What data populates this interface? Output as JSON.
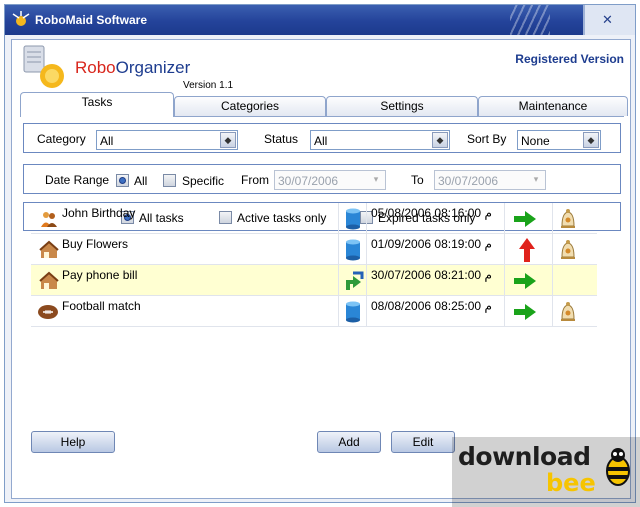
{
  "window": {
    "title": "RoboMaid Software"
  },
  "header": {
    "brand_part1": "Robo",
    "brand_part2": "Organizer",
    "version": "Version 1.1",
    "registration": "Registered Version"
  },
  "tabs": [
    {
      "label": "Tasks",
      "active": true
    },
    {
      "label": "Categories",
      "active": false
    },
    {
      "label": "Settings",
      "active": false
    },
    {
      "label": "Maintenance",
      "active": false
    }
  ],
  "filters": {
    "category_label": "Category",
    "category_value": "All",
    "status_label": "Status",
    "status_value": "All",
    "sortby_label": "Sort By",
    "sortby_value": "None"
  },
  "date_range": {
    "label": "Date Range",
    "option_all": "All",
    "option_specific": "Specific",
    "selected": "All",
    "from_label": "From",
    "from_value": "30/07/2006",
    "to_label": "To",
    "to_value": "30/07/2006"
  },
  "task_filter": {
    "option_all": "All tasks",
    "option_active": "Active tasks only",
    "option_expired": "Expired tasks only",
    "selected": "All tasks"
  },
  "tasks": [
    {
      "name": "John Birthday",
      "datetime": "05/08/2006 08:16:00 م",
      "category_icon": "people-icon",
      "status_icon": "database-icon",
      "action_icon": "right-arrow-icon",
      "alarm_icon": "alarm-bell-icon",
      "selected": false
    },
    {
      "name": "Buy Flowers",
      "datetime": "01/09/2006 08:19:00 م",
      "category_icon": "house-icon",
      "status_icon": "database-icon",
      "action_icon": "up-arrow-icon",
      "alarm_icon": "alarm-bell-icon",
      "selected": false
    },
    {
      "name": "Pay phone bill",
      "datetime": "30/07/2006 08:21:00 م",
      "category_icon": "house-icon",
      "status_icon": "recycle-icon",
      "action_icon": "right-arrow-icon",
      "alarm_icon": "",
      "selected": true
    },
    {
      "name": "Football match",
      "datetime": "08/08/2006 08:25:00 م",
      "category_icon": "football-icon",
      "status_icon": "database-icon",
      "action_icon": "right-arrow-icon",
      "alarm_icon": "alarm-bell-icon",
      "selected": false
    }
  ],
  "buttons": {
    "help": "Help",
    "add": "Add",
    "edit": "Edit"
  },
  "watermark": {
    "part1": "download",
    "part2": "bee"
  },
  "colors": {
    "title_bar": "#24439a",
    "brand_red": "#d8261c",
    "brand_blue": "#1d3c8f",
    "selection": "#ffffd2",
    "arrow_green": "#1aa31a",
    "arrow_red": "#e0221c"
  }
}
